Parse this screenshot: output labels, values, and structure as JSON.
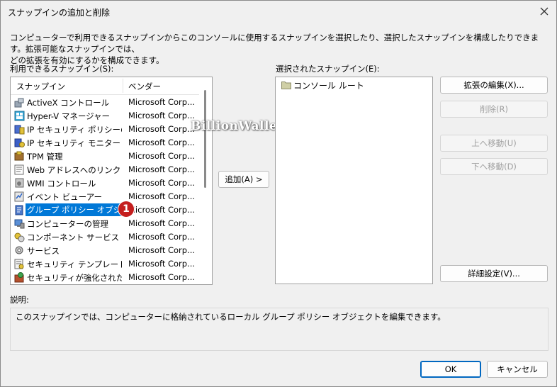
{
  "window": {
    "title": "スナップインの追加と削除"
  },
  "intro_text_line1": "コンピューターで利用できるスナップインからこのコンソールに使用するスナップインを選択したり、選択したスナップインを構成したりできます。拡張可能なスナップインでは、",
  "intro_text_line2": "どの拡張を有効にするかを構成できます。",
  "available": {
    "label": "利用できるスナップイン(S):",
    "col_snapin": "スナップイン",
    "col_vendor": "ベンダー",
    "rows": [
      {
        "name": "ActiveX コントロール",
        "vendor": "Microsoft Corp...",
        "icon": "activex-icon"
      },
      {
        "name": "Hyper-V マネージャー",
        "vendor": "Microsoft Corp...",
        "icon": "hyperv-icon"
      },
      {
        "name": "IP セキュリティ ポリシーの管...",
        "vendor": "Microsoft Corp...",
        "icon": "ip-security-policy-icon"
      },
      {
        "name": "IP セキュリティ モニター",
        "vendor": "Microsoft Corp...",
        "icon": "ip-security-monitor-icon"
      },
      {
        "name": "TPM 管理",
        "vendor": "Microsoft Corp...",
        "icon": "tpm-icon"
      },
      {
        "name": "Web アドレスへのリンク",
        "vendor": "Microsoft Corp...",
        "icon": "web-link-icon"
      },
      {
        "name": "WMI コントロール",
        "vendor": "Microsoft Corp...",
        "icon": "wmi-icon"
      },
      {
        "name": "イベント ビューアー",
        "vendor": "Microsoft Corp...",
        "icon": "event-viewer-icon"
      },
      {
        "name": "グループ ポリシー オブジェク...",
        "vendor": "Microsoft Corp...",
        "icon": "group-policy-icon"
      },
      {
        "name": "コンピューターの管理",
        "vendor": "Microsoft Corp...",
        "icon": "computer-management-icon"
      },
      {
        "name": "コンポーネント サービス",
        "vendor": "Microsoft Corp...",
        "icon": "component-services-icon"
      },
      {
        "name": "サービス",
        "vendor": "Microsoft Corp...",
        "icon": "services-icon"
      },
      {
        "name": "セキュリティ テンプレート",
        "vendor": "Microsoft Corp...",
        "icon": "security-template-icon"
      },
      {
        "name": "セキュリティが強化された ...",
        "vendor": "Microsoft Corp...",
        "icon": "firewall-icon"
      }
    ],
    "selected_index": 8
  },
  "add_button": "追加(A) >",
  "selected": {
    "label": "選択されたスナップイン(E):",
    "items": [
      "コンソール ルート"
    ]
  },
  "buttons": {
    "edit_extensions": "拡張の編集(X)...",
    "remove": "削除(R)",
    "move_up": "上へ移動(U)",
    "move_down": "下へ移動(D)",
    "advanced": "詳細設定(V)...",
    "ok": "OK",
    "cancel": "キャンセル"
  },
  "description": {
    "label": "説明:",
    "text": "このスナップインでは、コンピューターに格納されているローカル グループ ポリシー オブジェクトを編集できます。"
  },
  "annotation_badge": "1",
  "watermark": "BillionWallet.com",
  "colors": {
    "selection": "#0078d7",
    "badge": "#c41e1e",
    "default_button_border": "#0067c0"
  }
}
